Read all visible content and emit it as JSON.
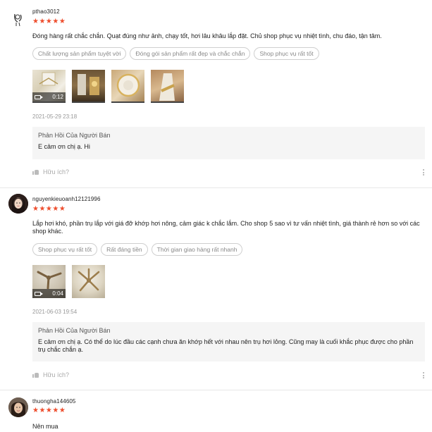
{
  "reviews": [
    {
      "username": "pthao3012",
      "stars": "★★★★★",
      "rating": 5,
      "comment": "Đóng hàng rất chắc chắn. Quạt đúng như ảnh, chạy tốt, hơi lâu khâu lắp đặt. Chủ shop phục vụ nhiệt tình, chu đáo, tận tâm.",
      "tags": [
        "Chất lượng sản phẩm tuyệt vời",
        "Đóng gói sản phẩm rất đẹp và chắc chắn",
        "Shop phục vụ rất tốt"
      ],
      "video_duration": "0:12",
      "date": "2021-05-29 23:18",
      "seller_reply_title": "Phản Hồi Của Người Bán",
      "seller_reply": "E cảm ơn chị ạ. Hi",
      "helpful_label": "Hữu ích?"
    },
    {
      "username": "nguyenkieuoanh12121996",
      "stars": "★★★★★",
      "rating": 5,
      "comment": "Lắp hơi khó, phần trụ lắp với giá đỡ khớp hơi nông, cảm giác k chắc lắm. Cho shop 5 sao vì tư vấn nhiệt tình, giá thành rẻ hơn so với các shop khác.",
      "tags": [
        "Shop phục vụ rất tốt",
        "Rất đáng tiền",
        "Thời gian giao hàng rất nhanh"
      ],
      "video_duration": "0:04",
      "date": "2021-06-03 19:54",
      "seller_reply_title": "Phản Hồi Của Người Bán",
      "seller_reply": "E cảm ơn chị ạ. Có thể do lúc đầu các cạnh chưa ăn khớp hết với nhau nên trụ  hơi lỏng. Cũng may là cuối  khắc phục được cho phần trụ chắc chắn ạ.",
      "helpful_label": "Hữu ích?"
    },
    {
      "username": "thuongha144605",
      "stars": "★★★★★",
      "rating": 5,
      "comment": "Nên mua"
    }
  ]
}
